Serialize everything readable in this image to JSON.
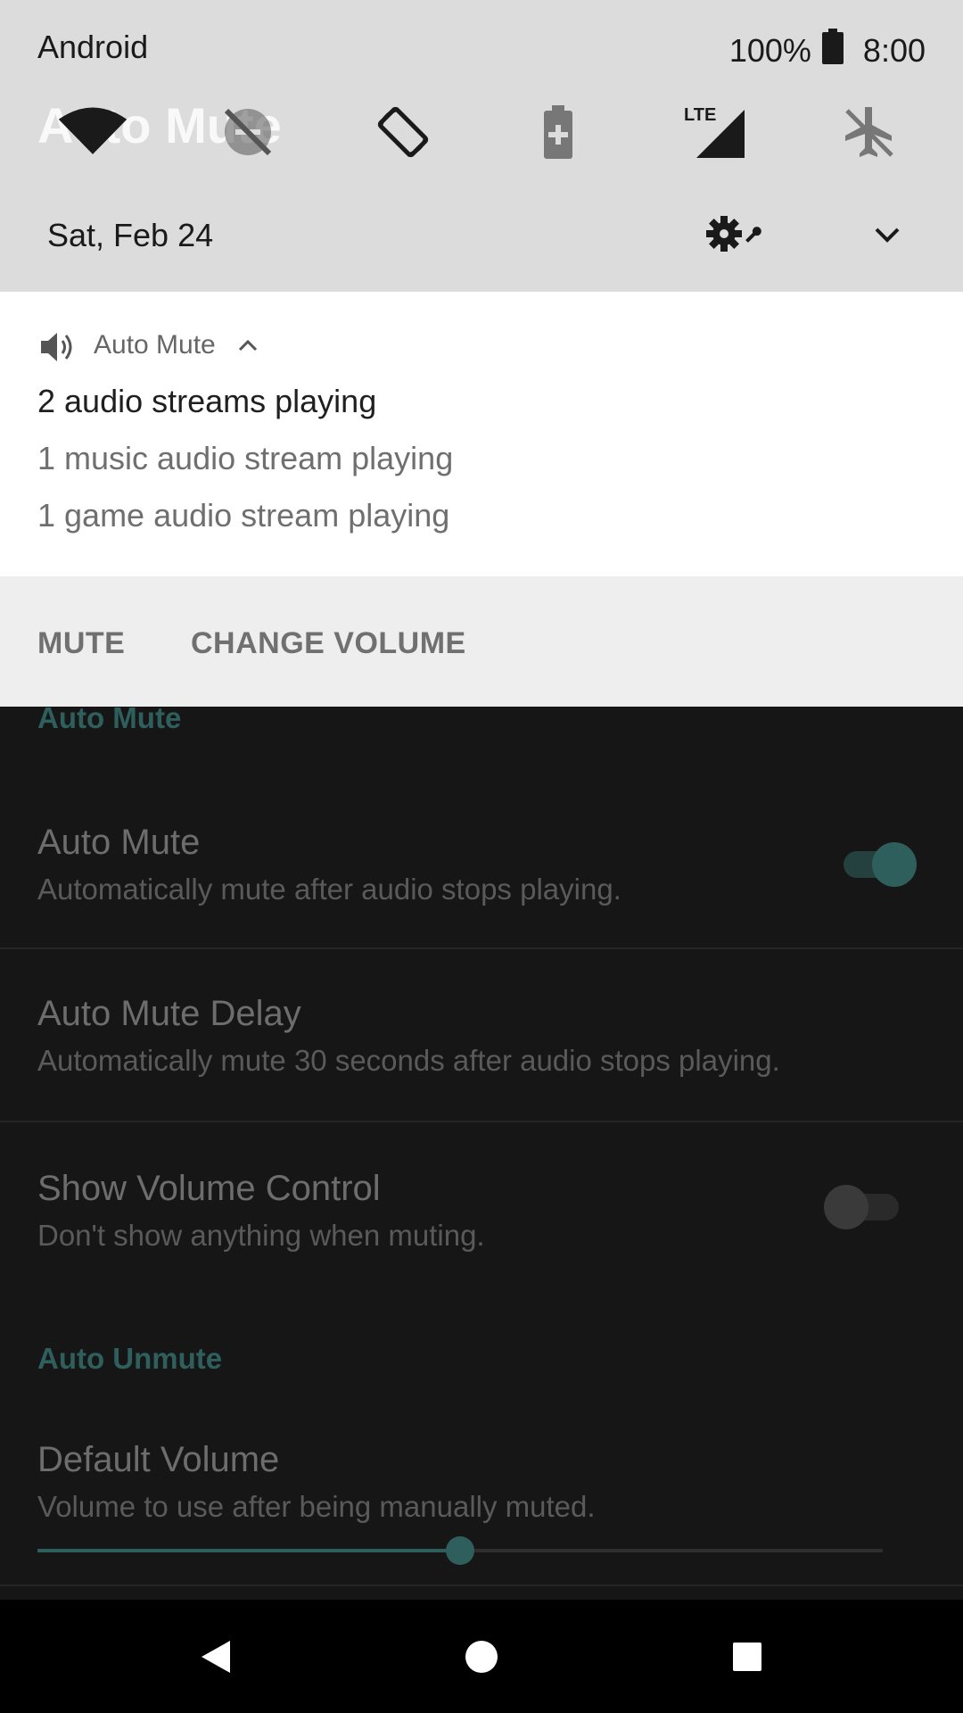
{
  "status_bar": {
    "carrier": "Android",
    "battery": "100%",
    "time": "8:00"
  },
  "quick_settings": {
    "date": "Sat, Feb 24",
    "tiles": [
      "wifi-icon",
      "do-not-disturb-off-icon",
      "auto-rotate-icon",
      "battery-saver-icon",
      "lte-signal-icon",
      "airplane-mode-icon"
    ]
  },
  "background_app": {
    "title": "Auto Mute"
  },
  "notification": {
    "app_name": "Auto Mute",
    "title": "2 audio streams playing",
    "lines": [
      "1 music audio stream playing",
      "1 game audio stream playing"
    ],
    "actions": {
      "mute": "MUTE",
      "change_volume": "CHANGE VOLUME"
    }
  },
  "settings": {
    "auto_mute_header": "Auto Mute",
    "auto_mute": {
      "title": "Auto Mute",
      "summary": "Automatically mute after audio stops playing.",
      "enabled": true
    },
    "auto_mute_delay": {
      "title": "Auto Mute Delay",
      "summary": "Automatically mute 30 seconds after audio stops playing."
    },
    "show_volume_control": {
      "title": "Show Volume Control",
      "summary": "Don't show anything when muting.",
      "enabled": false
    },
    "auto_unmute_header": "Auto Unmute",
    "default_volume": {
      "title": "Default Volume",
      "summary": "Volume to use after being manually muted.",
      "value_fraction": 0.5
    }
  },
  "colors": {
    "accent_dim": "#2f5f5c",
    "shade_bg": "#dcdcdc",
    "notif_bg": "#ffffff",
    "actions_bg": "#eeeeee"
  }
}
